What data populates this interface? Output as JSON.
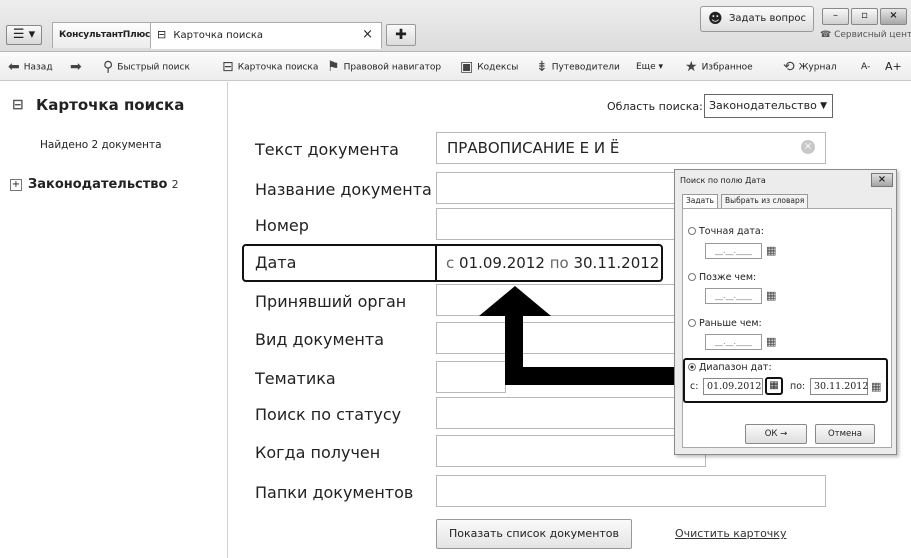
{
  "titlebar": {
    "menu_icon": "hamburger-icon",
    "menu_label": "☰ ▾",
    "tab1_label": "КонсультантПлюс",
    "tab2_label": "Карточка поиска",
    "tab2_close": "×",
    "tab_add": "✚",
    "ask_label": "Задать вопрос",
    "service_label": "Сервисный центр"
  },
  "toolbar": {
    "back": "Назад",
    "quick_search": "Быстрый поиск",
    "search_card": "Карточка поиска",
    "navigator": "Правовой навигатор",
    "codes": "Кодексы",
    "guides": "Путеводители",
    "more": "Еще ▾",
    "favorites": "Избранное",
    "journal": "Журнал",
    "font_minus": "A-",
    "font_plus": "A+"
  },
  "sidebar": {
    "title": "Карточка поиска",
    "found": "Найдено 2 документа",
    "tree_item": "Законодательство",
    "tree_count": "2"
  },
  "main": {
    "area_label": "Область поиска:",
    "area_value": "Законодательство",
    "fields": [
      {
        "label": "Текст документа",
        "value": "ПРАВОПИСАНИЕ Е И Ё"
      },
      {
        "label": "Название документа",
        "value": ""
      },
      {
        "label": "Номер",
        "value": ""
      },
      {
        "label": "Дата",
        "value": ""
      },
      {
        "label": "Принявший орган",
        "value": ""
      },
      {
        "label": "Вид документа",
        "value": ""
      },
      {
        "label": "Тематика",
        "value": ""
      },
      {
        "label": "Поиск по статусу",
        "value": ""
      },
      {
        "label": "Когда получен",
        "value": ""
      },
      {
        "label": "Папки документов",
        "value": ""
      }
    ],
    "date_from_prefix": "с",
    "date_from": "01.09.2012",
    "date_to_prefix": "по",
    "date_to": "30.11.2012",
    "show_button": "Показать список документов",
    "clear_link": "Очистить карточку"
  },
  "dialog": {
    "title": "Поиск по полю Дата",
    "tab_set": "Задать",
    "tab_dict": "Выбрать из словаря",
    "exact": "Точная дата:",
    "later": "Позже чем:",
    "earlier": "Раньше чем:",
    "range": "Диапазон дат:",
    "empty_date": "__.__.____",
    "from_label": "с:",
    "to_label": "по:",
    "from_value": "01.09.2012",
    "to_value": "30.11.2012",
    "ok": "ОК →",
    "cancel": "Отмена"
  },
  "colors": {
    "accent": "#111111",
    "panel": "#ececec"
  }
}
